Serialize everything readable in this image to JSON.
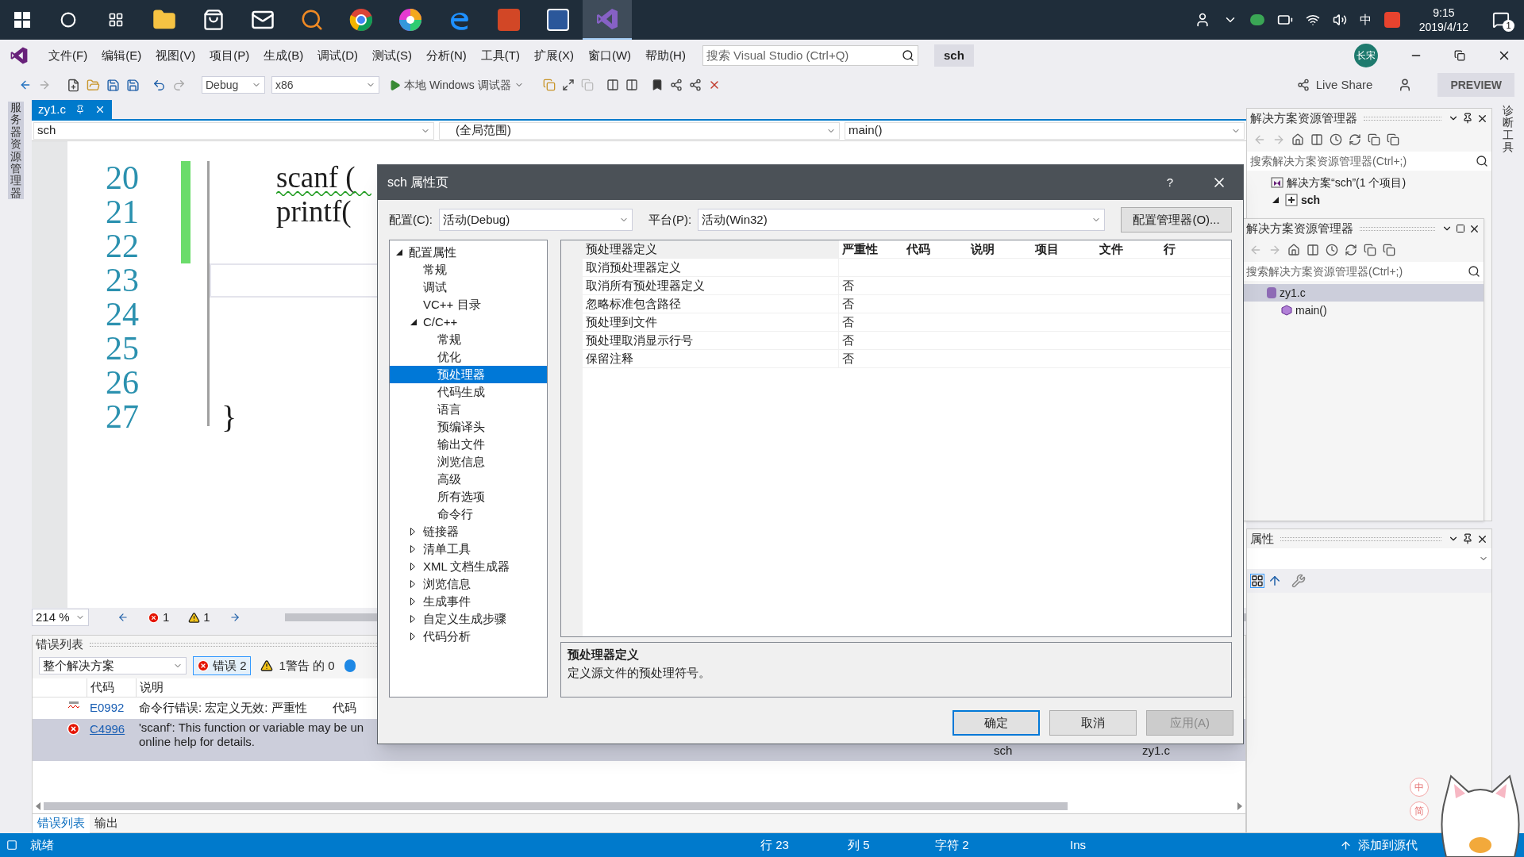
{
  "taskbar": {
    "apps": [
      {
        "active": false
      },
      {
        "active": false
      },
      {
        "active": false
      },
      {
        "active": false
      },
      {
        "active": false
      },
      {
        "active": false
      },
      {
        "active": false
      },
      {
        "active": false
      },
      {
        "active": false
      },
      {
        "active": true
      }
    ],
    "ime": "中",
    "time": "9:15",
    "date": "2019/4/12",
    "notifications": "1"
  },
  "menu": [
    "文件(F)",
    "编辑(E)",
    "视图(V)",
    "项目(P)",
    "生成(B)",
    "调试(D)",
    "测试(S)",
    "分析(N)",
    "工具(T)",
    "扩展(X)",
    "窗口(W)",
    "帮助(H)"
  ],
  "search": {
    "placeholder": "搜索 Visual Studio (Ctrl+Q)"
  },
  "solution_name": "sch",
  "avatar": "长宋",
  "toolbar": {
    "configuration": "Debug",
    "platform": "x86",
    "run": "本地 Windows 调试器",
    "live_share": "Live Share",
    "preview": "PREVIEW"
  },
  "left_strip": "服务器资源管理器",
  "right_strip": "诊断工具",
  "document_tabs": [
    {
      "label": "zy1.c",
      "selected": true
    }
  ],
  "nav_bar": {
    "project": "sch",
    "scope": "(全局范围)",
    "member": "main()"
  },
  "editor": {
    "lines": [
      {
        "number": "20",
        "kind": "statement",
        "code": "scanf (",
        "changed": true,
        "squiggle": true,
        "current": false
      },
      {
        "number": "21",
        "kind": "statement",
        "code": "printf(",
        "changed": true,
        "squiggle": false,
        "current": false
      },
      {
        "number": "22",
        "kind": "empty",
        "changed": true,
        "current": false
      },
      {
        "number": "23",
        "kind": "empty",
        "changed": false,
        "current": true
      },
      {
        "number": "24",
        "kind": "empty",
        "changed": false,
        "current": false
      },
      {
        "number": "25",
        "kind": "empty",
        "changed": false,
        "current": false
      },
      {
        "number": "26",
        "kind": "empty",
        "changed": false,
        "current": false
      },
      {
        "number": "27",
        "kind": "block_end",
        "code": "}",
        "changed": false,
        "current": false
      }
    ],
    "zoom": "214 %",
    "errors": "1",
    "warnings": "1"
  },
  "error_list": {
    "title": "错误列表",
    "scope": "整个解决方案",
    "errors_filter": {
      "label": "错误 2",
      "selected": true
    },
    "warnings_filter": "1警告 的 0",
    "columns": [
      "代码",
      "说明"
    ],
    "rows": [
      {
        "kind": "intellisense",
        "code": "E0992",
        "description": [
          "命令行错误: 宏定义无效: 严重性",
          "代码"
        ],
        "selected": false
      },
      {
        "kind": "error",
        "code": "C4996",
        "description": [
          "'scanf': This function or variable may be un",
          "online help for details."
        ],
        "project": "sch",
        "file": "zy1.c",
        "selected": true
      }
    ]
  },
  "bottom_tabs": [
    {
      "label": "错误列表",
      "selected": true
    },
    {
      "label": "输出",
      "selected": false
    }
  ],
  "status_bar": {
    "state": "就绪",
    "line": "行 23",
    "column": "列 5",
    "char": "字符 2",
    "mode": "Ins",
    "source_control": "添加到源代"
  },
  "solution_explorer": {
    "title": "解决方案资源管理器",
    "search": {
      "placeholder": "搜索解决方案资源管理器(Ctrl+;)"
    },
    "items": [
      {
        "label": "解决方案“sch”(1 个项目)",
        "kind": "solution",
        "selected": false,
        "children": [
          {
            "label": "sch",
            "kind": "project",
            "expanded": true,
            "selected": false
          }
        ]
      }
    ]
  },
  "solution_explorer_2": {
    "title": "解决方案资源管理器",
    "search": {
      "placeholder": "搜索解决方案资源管理器(Ctrl+;)"
    },
    "items": [
      {
        "label": "zy1.c",
        "kind": "file",
        "selected": true,
        "children": [
          {
            "label": "main()",
            "kind": "function",
            "selected": false
          }
        ]
      }
    ]
  },
  "properties_panel": {
    "title": "属性"
  },
  "ime_float": [
    "中",
    "简"
  ],
  "dialog": {
    "title": "sch 属性页",
    "help": "?",
    "config_label": "配置(C):",
    "config": "活动(Debug)",
    "platform_label": "平台(P):",
    "platform": "活动(Win32)",
    "manager_button": "配置管理器(O)...",
    "tree": [
      {
        "label": "配置属性",
        "expanded": true,
        "selected": false,
        "children": [
          {
            "label": "常规",
            "selected": false
          },
          {
            "label": "调试",
            "selected": false
          },
          {
            "label": "VC++ 目录",
            "selected": false
          },
          {
            "label": "C/C++",
            "expanded": true,
            "selected": false,
            "children": [
              {
                "label": "常规",
                "selected": false
              },
              {
                "label": "优化",
                "selected": false
              },
              {
                "label": "预处理器",
                "selected": true
              },
              {
                "label": "代码生成",
                "selected": false
              },
              {
                "label": "语言",
                "selected": false
              },
              {
                "label": "预编译头",
                "selected": false
              },
              {
                "label": "输出文件",
                "selected": false
              },
              {
                "label": "浏览信息",
                "selected": false
              },
              {
                "label": "高级",
                "selected": false
              },
              {
                "label": "所有选项",
                "selected": false
              },
              {
                "label": "命令行",
                "selected": false
              }
            ]
          },
          {
            "label": "链接器",
            "expanded": false,
            "selected": false
          },
          {
            "label": "清单工具",
            "expanded": false,
            "selected": false
          },
          {
            "label": "XML 文档生成器",
            "expanded": false,
            "selected": false
          },
          {
            "label": "浏览信息",
            "expanded": false,
            "selected": false
          },
          {
            "label": "生成事件",
            "expanded": false,
            "selected": false
          },
          {
            "label": "自定义生成步骤",
            "expanded": false,
            "selected": false
          },
          {
            "label": "代码分析",
            "expanded": false,
            "selected": false
          }
        ]
      }
    ],
    "grid": [
      {
        "name": "预处理器定义",
        "selected": true
      },
      {
        "name": "取消预处理器定义",
        "selected": false
      },
      {
        "name": "取消所有预处理器定义",
        "value": "否",
        "selected": false
      },
      {
        "name": "忽略标准包含路径",
        "value": "否",
        "selected": false
      },
      {
        "name": "预处理到文件",
        "value": "否",
        "selected": false
      },
      {
        "name": "预处理取消显示行号",
        "value": "否",
        "selected": false
      },
      {
        "name": "保留注释",
        "value": "否",
        "selected": false
      }
    ],
    "stray_headers": [
      "严重性",
      "代码",
      "说明",
      "项目",
      "文件",
      "行"
    ],
    "description": {
      "title": "预处理器定义",
      "text": "定义源文件的预处理符号。"
    },
    "buttons": [
      {
        "label": "确定",
        "kind": "default",
        "disabled": false
      },
      {
        "label": "取消",
        "kind": "normal",
        "disabled": false
      },
      {
        "label": "应用(A)",
        "kind": "normal",
        "disabled": true
      }
    ]
  }
}
